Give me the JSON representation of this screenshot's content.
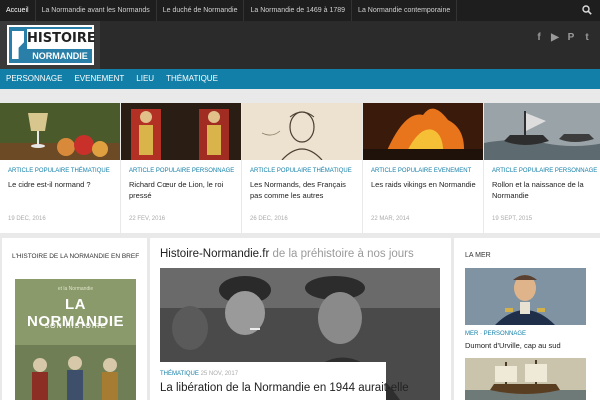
{
  "topbar": {
    "menu": [
      "Accueil",
      "La Normandie avant les Normands",
      "Le duché de Normandie",
      "La Normandie de 1469 à 1789",
      "La Normandie contemporaine"
    ],
    "search_icon": "search-icon"
  },
  "logo": {
    "line1": "HISTOIRE",
    "line2": "NORMANDIE"
  },
  "social": {
    "icons": [
      "facebook-icon",
      "youtube-icon",
      "pinterest-icon",
      "twitter-icon"
    ],
    "glyphs": [
      "f",
      "▶",
      "P",
      "t"
    ]
  },
  "nav": {
    "items": [
      "PERSONNAGE",
      "EVENEMENT",
      "LIEU",
      "THÉMATIQUE"
    ]
  },
  "cards": [
    {
      "category": "ARTICLE POPULAIRE THÉMATIQUE",
      "title": "Le cidre est-il normand ?",
      "date": "19 DEC, 2016"
    },
    {
      "category": "ARTICLE POPULAIRE PERSONNAGE",
      "title": "Richard Cœur de Lion, le roi pressé",
      "date": "22 FEV, 2016"
    },
    {
      "category": "ARTICLE POPULAIRE THÉMATIQUE",
      "title": "Les Normands, des Français pas comme les autres",
      "date": "26 DEC, 2016"
    },
    {
      "category": "ARTICLE POPULAIRE EVENEMENT",
      "title": "Les raids vikings en Normandie",
      "date": "22 MAR, 2014"
    },
    {
      "category": "ARTICLE POPULAIRE PERSONNAGE",
      "title": "Rollon et la naissance de la Normandie",
      "date": "19 SEPT, 2015"
    }
  ],
  "left": {
    "heading": "L'HISTOIRE DE LA NORMANDIE EN BREF",
    "book_top": "et la Normandie",
    "book_title": "LA NORMANDIE",
    "book_sub": "SON HISTOIRE"
  },
  "main": {
    "site": "Histoire-Normandie.fr",
    "tagline": " de la préhistoire à nos jours",
    "category": "THÉMATIQUE",
    "date": "25 NOV, 2017",
    "title": "La libération de la Normandie en 1944 aurait-elle"
  },
  "right": {
    "heading": "LA MER",
    "category": "MER · PERSONNAGE",
    "title": "Dumont d'Urville, cap au sud"
  },
  "colors": {
    "accent": "#127fa8",
    "topbar": "#1e1e1e",
    "header": "#2b2b2b"
  }
}
